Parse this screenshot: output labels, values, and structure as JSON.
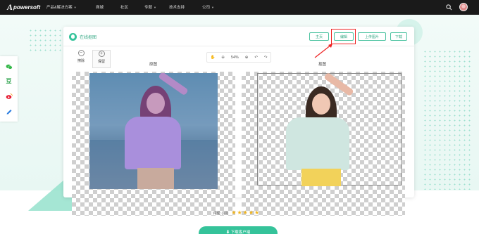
{
  "nav": {
    "logo_letter": "A",
    "logo_rest": "powersoft",
    "items": [
      "产品&解决方案",
      "商城",
      "社区",
      "专题",
      "技术支持",
      "公司"
    ]
  },
  "editor": {
    "brand_title": "在线抠图",
    "buttons": [
      "主页",
      "编辑",
      "上传图片",
      "下载"
    ],
    "tools": {
      "erase_label": "擦除",
      "keep_label": "保留",
      "zoom_value": "54%"
    },
    "label_original": "原图",
    "label_cutout": "抠图"
  },
  "rating": {
    "label": "评论 (10)",
    "stars": 5
  },
  "download_label": "⬇ 下载客户端",
  "colors": {
    "accent": "#35c39a",
    "nav_bg": "#1a1a1a",
    "highlight": "#e22222",
    "star": "#f2b51b"
  },
  "icons": {
    "share": [
      "wechat-icon",
      "douban-icon",
      "weibo-icon",
      "pen-icon"
    ],
    "zoom_tools": [
      "hand-icon",
      "zoom-out-icon",
      "zoom-in-icon",
      "undo-icon",
      "redo-icon"
    ]
  }
}
